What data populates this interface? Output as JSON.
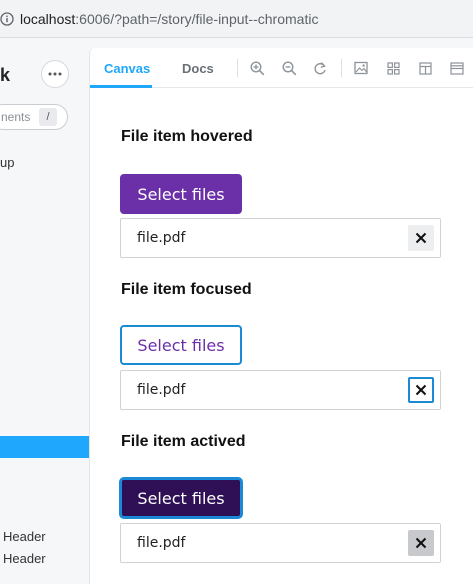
{
  "browser": {
    "host": "localhost",
    "path": ":6006/?path=/story/file-input--chromatic"
  },
  "sidebar": {
    "logo_fragment": "k",
    "search_placeholder": "nents",
    "search_shortcut": "/",
    "group_fragment": "up",
    "items": [
      {
        "label": "Header"
      },
      {
        "label": "Header"
      }
    ]
  },
  "toolbar": {
    "tabs": [
      {
        "label": "Canvas",
        "active": true
      },
      {
        "label": "Docs",
        "active": false
      }
    ],
    "icons": [
      "zoom-in-icon",
      "zoom-out-icon",
      "reset-zoom-icon",
      "background-icon",
      "grid-icon",
      "viewport-icon",
      "outline-icon"
    ]
  },
  "stories": [
    {
      "title": "File item hovered",
      "button_label": "Select files",
      "file_name": "file.pdf",
      "state": "hovered"
    },
    {
      "title": "File item focused",
      "button_label": "Select files",
      "file_name": "file.pdf",
      "state": "focused"
    },
    {
      "title": "File item actived",
      "button_label": "Select files",
      "file_name": "file.pdf",
      "state": "actived"
    }
  ],
  "colors": {
    "accent": "#1ea7fd",
    "button_purple": "#6b2fa8",
    "button_dark_purple": "#2f0f55",
    "focus_ring": "#1a8ad6"
  }
}
